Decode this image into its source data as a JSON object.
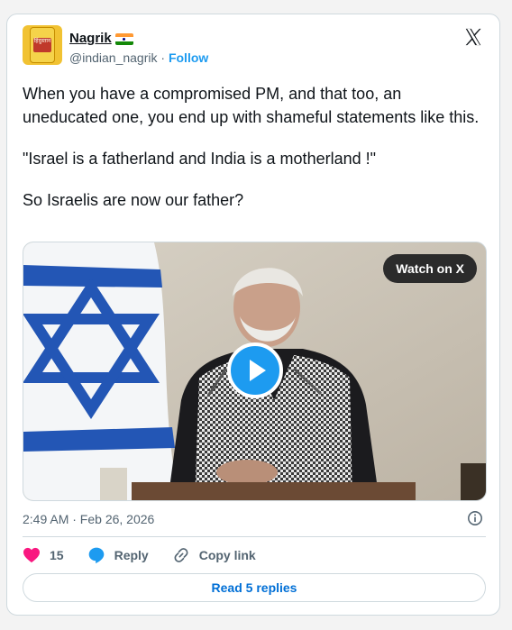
{
  "author": {
    "name": "Nagrik",
    "handle": "@indian_nagrik",
    "separator": "·",
    "follow_label": "Follow",
    "avatar_text": "हिंदुस्तान चूरण"
  },
  "platform_icon": "x-logo-icon",
  "tweet": {
    "paragraphs": [
      "When you have a compromised PM, and that too, an uneducated one, you end up with shameful statements like this.",
      "\"Israel is a fatherland and India is a motherland !\"",
      "So Israelis are now our father?"
    ]
  },
  "media": {
    "watch_label": "Watch on X",
    "play_icon": "play-icon"
  },
  "timestamp": "2:49 AM · Feb 26, 2026",
  "info_icon": "info-icon",
  "actions": {
    "like_count": "15",
    "reply_label": "Reply",
    "copy_label": "Copy link"
  },
  "read_replies_label": "Read 5 replies",
  "colors": {
    "accent": "#1d9bf0",
    "like": "#f91880",
    "link": "#006fd6",
    "text": "#0f1419",
    "muted": "#536471"
  }
}
